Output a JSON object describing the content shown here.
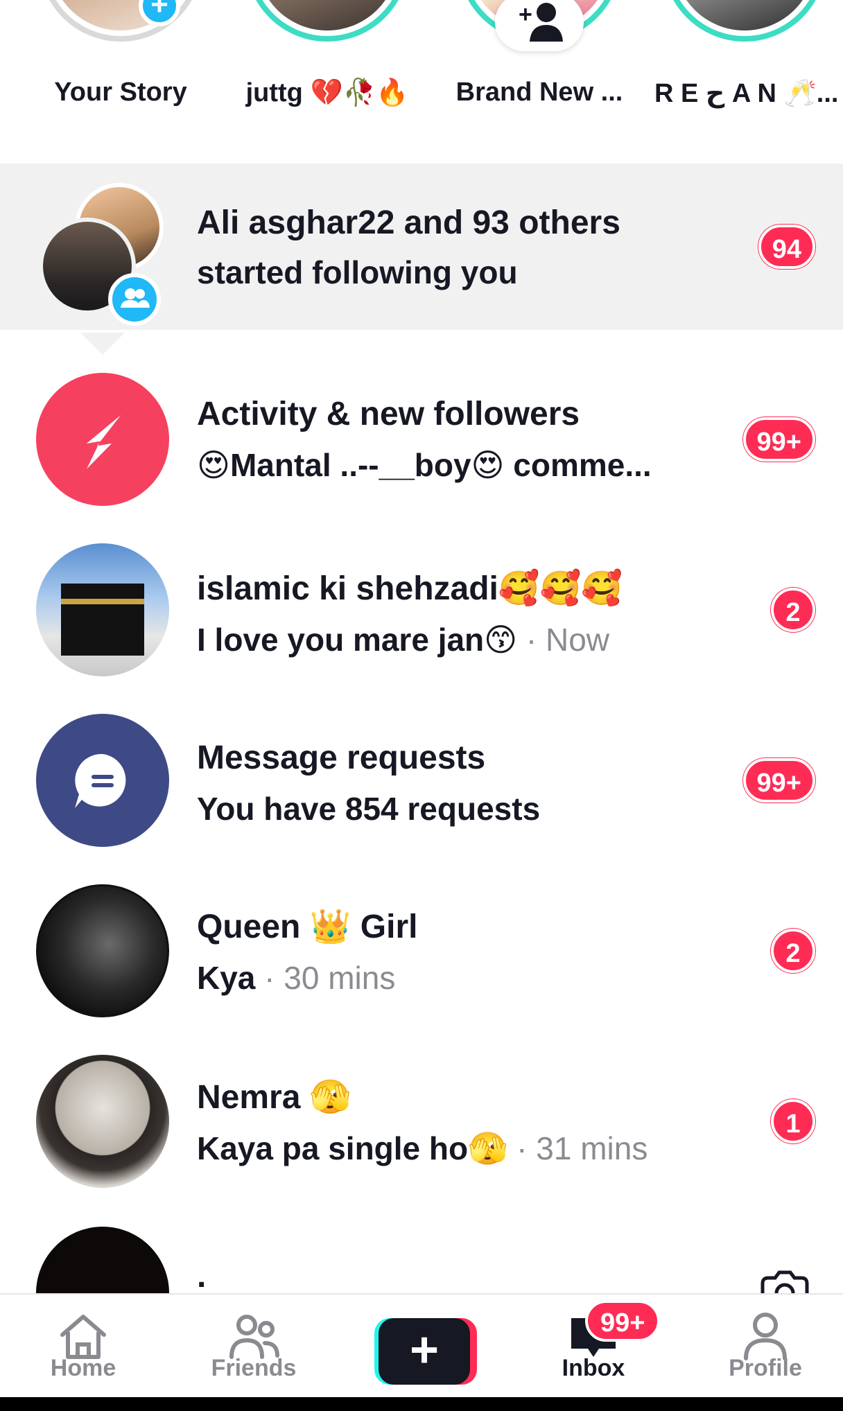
{
  "stories": [
    {
      "label": "Your Story",
      "has_add": true
    },
    {
      "label": "juttg 💔🥀🔥",
      "has_add": false
    },
    {
      "label": "Brand New ...",
      "has_add": false,
      "add_friend": true
    },
    {
      "label": "R E ح A N 🥂...",
      "has_add": false
    }
  ],
  "rows": [
    {
      "title": "Ali asghar22 and 93 others",
      "subtitle": "started following you",
      "time": "",
      "badge": "94",
      "avatar": "follower-group"
    },
    {
      "title": "Activity & new followers",
      "subtitle": "😍Mantal ..--__boy😍 comme...",
      "time": "",
      "badge": "99+",
      "avatar": "activity"
    },
    {
      "title": "islamic ki shehzadi🥰🥰🥰",
      "subtitle": "I love you mare jan😙",
      "time": " · Now",
      "badge": "2",
      "avatar": "kaaba"
    },
    {
      "title": "Message requests",
      "subtitle": "You have 854 requests",
      "time": "",
      "badge": "99+",
      "avatar": "message"
    },
    {
      "title": "Queen 👑 Girl",
      "subtitle": "Kya",
      "time": " · 30 mins",
      "badge": "2",
      "avatar": "dark-user"
    },
    {
      "title": "Nemra 🫣",
      "subtitle": "Kaya pa single ho🫣",
      "time": " · 31 mins",
      "badge": "1",
      "avatar": "woman"
    },
    {
      "title": ".",
      "subtitle": "",
      "time": "",
      "badge": "",
      "avatar": "black"
    }
  ],
  "nav": {
    "home": "Home",
    "friends": "Friends",
    "create": "+",
    "inbox": "Inbox",
    "inbox_badge": "99+",
    "profile": "Profile"
  },
  "colors": {
    "accent": "#fe2c55",
    "teal": "#25f4ee",
    "activity": "#f6405f",
    "message": "#3e4a86",
    "story_ring": "#3ddcc4",
    "blue_badge": "#20b8f6"
  }
}
